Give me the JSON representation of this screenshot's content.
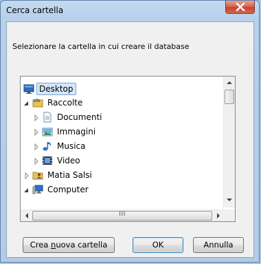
{
  "dialog": {
    "title": "Cerca cartella",
    "instruction": "Selezionare la cartella in cui creare il database"
  },
  "tree": {
    "items": [
      {
        "label": "Desktop",
        "icon": "desktop-icon",
        "expander": "none",
        "selected": true
      },
      {
        "label": "Raccolte",
        "icon": "libraries-icon",
        "expander": "expanded"
      },
      {
        "label": "Documenti",
        "icon": "documents-icon",
        "expander": "collapsed"
      },
      {
        "label": "Immagini",
        "icon": "pictures-icon",
        "expander": "collapsed"
      },
      {
        "label": "Musica",
        "icon": "music-icon",
        "expander": "collapsed"
      },
      {
        "label": "Video",
        "icon": "video-icon",
        "expander": "collapsed"
      },
      {
        "label": "Matia Salsi",
        "icon": "user-folder-icon",
        "expander": "collapsed"
      },
      {
        "label": "Computer",
        "icon": "computer-icon",
        "expander": "expanded"
      }
    ],
    "hscroll_center": "III"
  },
  "buttons": {
    "new_folder_pre": "Crea ",
    "new_folder_accel": "n",
    "new_folder_post": "uova cartella",
    "ok": "OK",
    "cancel": "Annulla"
  },
  "colors": {
    "selection": "#d5e6f8",
    "close_button": "#c3452c",
    "frame": "#b8d0ea"
  }
}
